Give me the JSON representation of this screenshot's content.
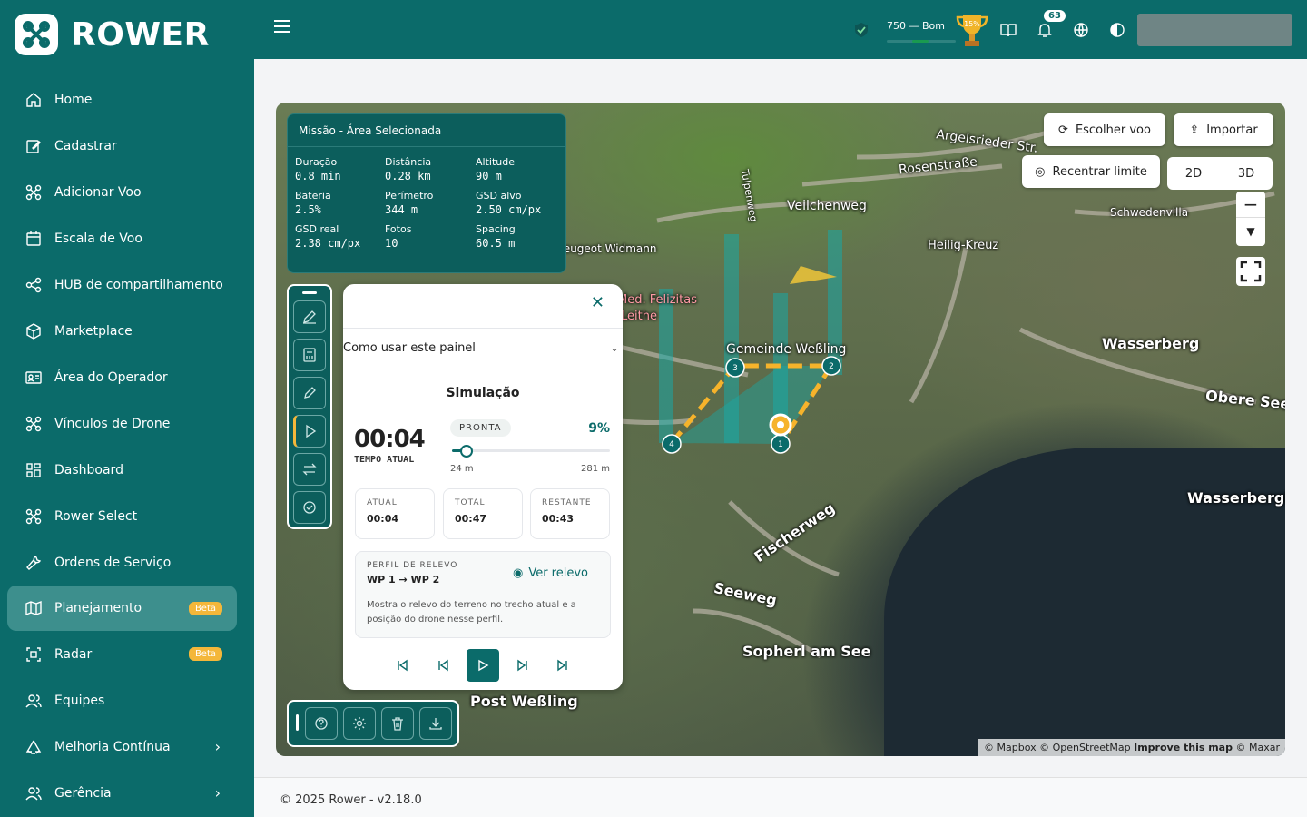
{
  "app": {
    "name": "ROWER"
  },
  "colors": {
    "primary": "#0b6b6a",
    "accent": "#f4b73a",
    "route": "#f6b32b"
  },
  "sidebar": {
    "items": [
      {
        "label": "Home",
        "icon": "home-icon"
      },
      {
        "label": "Cadastrar",
        "icon": "edit-icon"
      },
      {
        "label": "Adicionar Voo",
        "icon": "drone-icon"
      },
      {
        "label": "Escala de Voo",
        "icon": "calendar-icon"
      },
      {
        "label": "HUB de compartilhamento",
        "icon": "share-icon"
      },
      {
        "label": "Marketplace",
        "icon": "box-icon"
      },
      {
        "label": "Área do Operador",
        "icon": "id-card-icon"
      },
      {
        "label": "Vínculos de Drone",
        "icon": "drone-icon"
      },
      {
        "label": "Dashboard",
        "icon": "grid-icon"
      },
      {
        "label": "Rower Select",
        "icon": "drone-icon"
      },
      {
        "label": "Ordens de Serviço",
        "icon": "wrench-icon"
      },
      {
        "label": "Planejamento",
        "icon": "map-icon",
        "badge": "Beta",
        "active": true
      },
      {
        "label": "Radar",
        "icon": "radar-icon",
        "badge": "Beta"
      },
      {
        "label": "Equipes",
        "icon": "users-icon"
      },
      {
        "label": "Melhoria Contínua",
        "icon": "recycle-icon",
        "chevron": true
      },
      {
        "label": "Gerência",
        "icon": "users-icon",
        "chevron": true
      }
    ]
  },
  "header": {
    "score_text": "750 — Bom",
    "trophy_badge": "15%",
    "notifications": "63"
  },
  "mission": {
    "title": "Missão - Área Selecionada",
    "stats": [
      {
        "label": "Duração",
        "value": "0.8 min"
      },
      {
        "label": "Distância",
        "value": "0.28 km"
      },
      {
        "label": "Altitude",
        "value": "90 m"
      },
      {
        "label": "Bateria",
        "value": "2.5%"
      },
      {
        "label": "Perímetro",
        "value": "344 m"
      },
      {
        "label": "GSD alvo",
        "value": "2.50 cm/px"
      },
      {
        "label": "GSD real",
        "value": "2.38 cm/px"
      },
      {
        "label": "Fotos",
        "value": "10"
      },
      {
        "label": "Spacing",
        "value": "60.5 m"
      }
    ]
  },
  "map": {
    "choose_flight": "Escolher voo",
    "import": "Importar",
    "recenter": "Recentrar limite",
    "view_2d": "2D",
    "view_3d": "3D",
    "labels": {
      "argelsrieder": "Argelsrieder Str.",
      "rosenstrasse": "Rosenstraße",
      "veilchenweg": "Veilchenweg",
      "tulpenweg": "Tulpenweg",
      "schwedenvilla": "Schwedenvilla",
      "heilig_kreuz": "Heilig-Kreuz",
      "widmann": "Peugeot Widmann",
      "felizitas": "Med. Felizitas",
      "leithe": "Leithe",
      "gemeinde": "Gemeinde Weßling",
      "wasserberg": "Wasserberg",
      "obere_see": "Obere See",
      "wasserbergh": "Wasserbergh",
      "fischerweg": "Fischerweg",
      "seeweg": "Seeweg",
      "sopherl": "Sopherl am See",
      "post": "Post Weßling"
    },
    "waypoints": [
      "1",
      "2",
      "3",
      "4"
    ],
    "attribution": {
      "text": "© Mapbox © OpenStreetMap",
      "improve": "Improve this map",
      "maxar": "© Maxar"
    }
  },
  "simulation": {
    "how_to": "Como usar este painel",
    "title": "Simulação",
    "current_time": "00:04",
    "current_time_label": "TEMPO ATUAL",
    "status": "PRONTA",
    "progress_pct": "9%",
    "progress": 0.09,
    "range_start": "24 m",
    "range_end": "281 m",
    "boxes": [
      {
        "label": "ATUAL",
        "value": "00:04"
      },
      {
        "label": "TOTAL",
        "value": "00:47"
      },
      {
        "label": "RESTANTE",
        "value": "00:43"
      }
    ],
    "relief": {
      "label": "PERFIL DE RELEVO",
      "segment": "WP 1 → WP 2",
      "link": "Ver relevo",
      "description": "Mostra o relevo do terreno no trecho atual e a posição do drone nesse perfil."
    }
  },
  "footer": {
    "text": "© 2025 Rower - v2.18.0"
  }
}
